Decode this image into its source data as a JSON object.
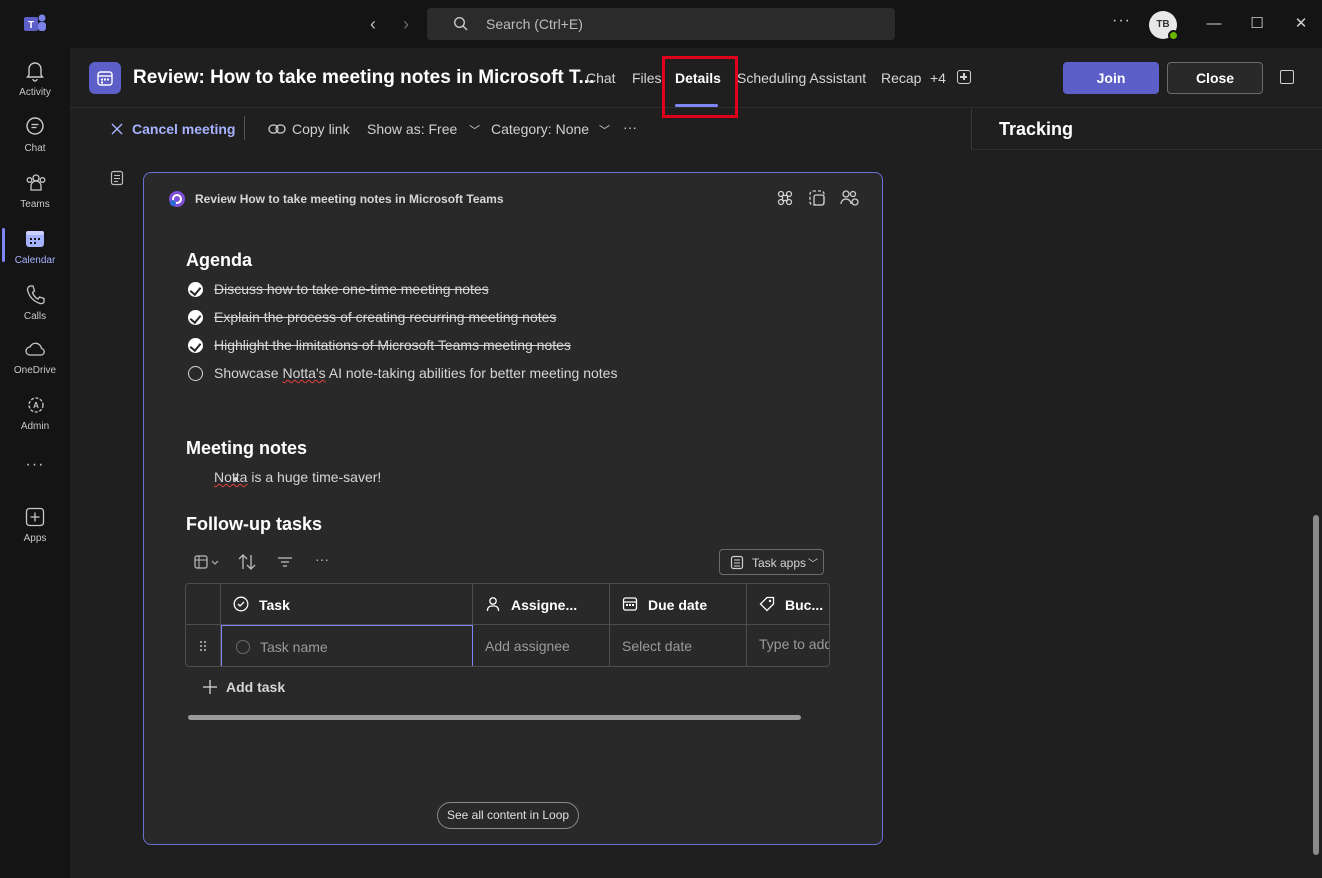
{
  "search": {
    "placeholder": "Search (Ctrl+E)"
  },
  "user": {
    "initials": "TB"
  },
  "rail": [
    {
      "label": "Activity",
      "icon": "bell-icon"
    },
    {
      "label": "Chat",
      "icon": "chat-icon"
    },
    {
      "label": "Teams",
      "icon": "teams-icon"
    },
    {
      "label": "Calendar",
      "icon": "calendar-icon",
      "active": true
    },
    {
      "label": "Calls",
      "icon": "phone-icon"
    },
    {
      "label": "OneDrive",
      "icon": "cloud-icon"
    },
    {
      "label": "Admin",
      "icon": "admin-icon"
    },
    {
      "label": "Apps",
      "icon": "add-app-icon"
    }
  ],
  "header": {
    "title": "Review: How to take meeting notes in Microsoft T...",
    "tabs": [
      "Chat",
      "Files",
      "Details",
      "Scheduling Assistant",
      "Recap",
      "+4"
    ],
    "active_tab": "Details",
    "join_label": "Join",
    "close_label": "Close"
  },
  "toolbar": {
    "cancel": "Cancel meeting",
    "copy_link": "Copy link",
    "show_as": "Show as: Free",
    "category": "Category: None",
    "more": "···"
  },
  "tracking": {
    "title": "Tracking"
  },
  "loop": {
    "title": "Review How to take meeting notes in Microsoft Teams",
    "agenda_heading": "Agenda",
    "agenda": [
      {
        "text": "Discuss how to take one-time meeting notes",
        "done": true
      },
      {
        "text": "Explain the process of creating recurring meeting notes",
        "done": true
      },
      {
        "text": "Highlight the limitations of Microsoft Teams meeting notes",
        "done": true
      },
      {
        "text_pre": "Showcase ",
        "text_squiggle": "Notta's",
        "text_post": " AI note-taking abilities for better meeting notes",
        "done": false
      }
    ],
    "notes_heading": "Meeting notes",
    "notes": [
      {
        "squiggle": "Notta",
        "rest": " is a huge time-saver!"
      }
    ],
    "tasks_heading": "Follow-up tasks",
    "task_apps": "Task apps",
    "columns": [
      "Task",
      "Assigne...",
      "Due date",
      "Buc..."
    ],
    "row_placeholders": [
      "Task name",
      "Add assignee",
      "Select date",
      "Type to add"
    ],
    "add_task": "Add task",
    "see_all": "See all content in Loop"
  },
  "colors": {
    "accent": "#5b5fc7",
    "accent_light": "#7f85f5",
    "highlight": "#e0001b"
  }
}
